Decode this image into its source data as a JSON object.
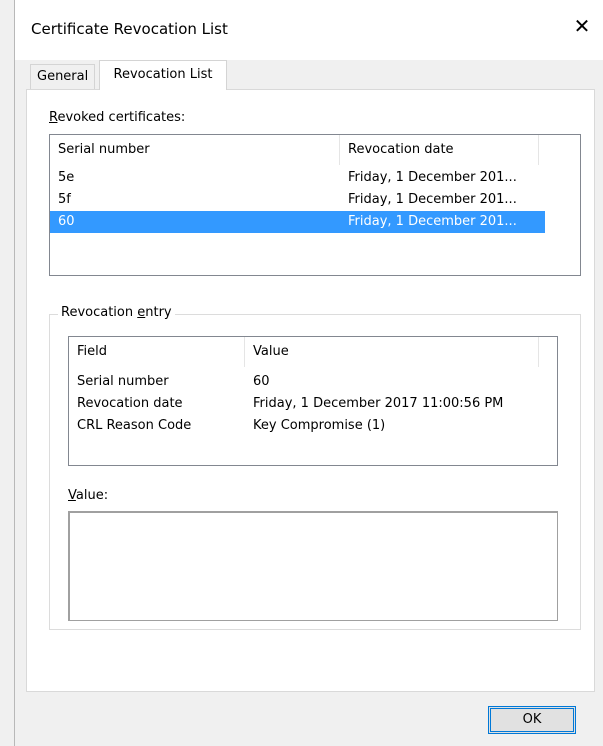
{
  "window": {
    "title": "Certificate Revocation List",
    "close_glyph": "✕"
  },
  "tabs": [
    {
      "label": "General",
      "selected": false
    },
    {
      "label": "Revocation List",
      "selected": true
    }
  ],
  "revoked": {
    "label_underlined": "R",
    "label_rest": "evoked certificates:",
    "columns": [
      "Serial number",
      "Revocation date"
    ],
    "rows": [
      {
        "serial": "5e",
        "date": "Friday, 1 December 201...",
        "selected": false
      },
      {
        "serial": "5f",
        "date": "Friday, 1 December 201...",
        "selected": false
      },
      {
        "serial": "60",
        "date": "Friday, 1 December 201...",
        "selected": true
      }
    ]
  },
  "entry": {
    "group_label_pre": "Revocation ",
    "group_label_underlined": "e",
    "group_label_post": "ntry",
    "columns": [
      "Field",
      "Value"
    ],
    "rows": [
      {
        "field": "Serial number",
        "value": "60"
      },
      {
        "field": "Revocation date",
        "value": "Friday, 1 December 2017 11:00:56 PM"
      },
      {
        "field": "CRL Reason Code",
        "value": "Key Compromise (1)"
      }
    ],
    "value_label_underlined": "V",
    "value_label_rest": "alue:",
    "value_text": ""
  },
  "buttons": {
    "ok_label": "OK"
  },
  "colors": {
    "selection": "#3399ff",
    "focus_border": "#0078d7"
  }
}
